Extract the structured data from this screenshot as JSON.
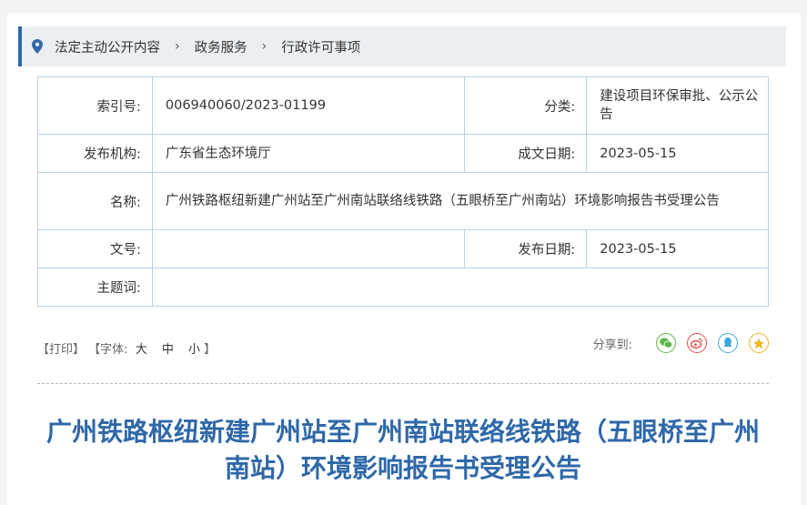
{
  "colors": {
    "accent": "#2f68a8",
    "border": "#b9d2e3",
    "breadcrumb_bg": "#eceff1"
  },
  "breadcrumb": {
    "icon": "location-pin-icon",
    "items": [
      "法定主动公开内容",
      "政务服务",
      "行政许可事项"
    ],
    "separator": "›"
  },
  "meta": {
    "index_label": "索引号:",
    "index_value": "006940060/2023-01199",
    "category_label": "分类:",
    "category_value": "建设项目环保审批、公示公告",
    "publisher_label": "发布机构:",
    "publisher_value": "广东省生态环境厅",
    "created_label": "成文日期:",
    "created_value": "2023-05-15",
    "name_label": "名称:",
    "name_value": "广州铁路枢纽新建广州站至广州南站联络线铁路（五眼桥至广州南站）环境影响报告书受理公告",
    "doc_no_label": "文号:",
    "doc_no_value": "",
    "published_label": "发布日期:",
    "published_value": "2023-05-15",
    "keywords_label": "主题词:",
    "keywords_value": ""
  },
  "toolbar": {
    "print": "【打印】",
    "font_prefix": "【字体:",
    "font_large": "大",
    "font_medium": "中",
    "font_small": "小",
    "font_suffix": "】",
    "share_label": "分享到:",
    "share_icons": [
      "wechat-icon",
      "weibo-icon",
      "qq-icon",
      "qzone-icon"
    ]
  },
  "article": {
    "title": "广州铁路枢纽新建广州站至广州南站联络线铁路（五眼桥至广州南站）环境影响报告书受理公告"
  }
}
